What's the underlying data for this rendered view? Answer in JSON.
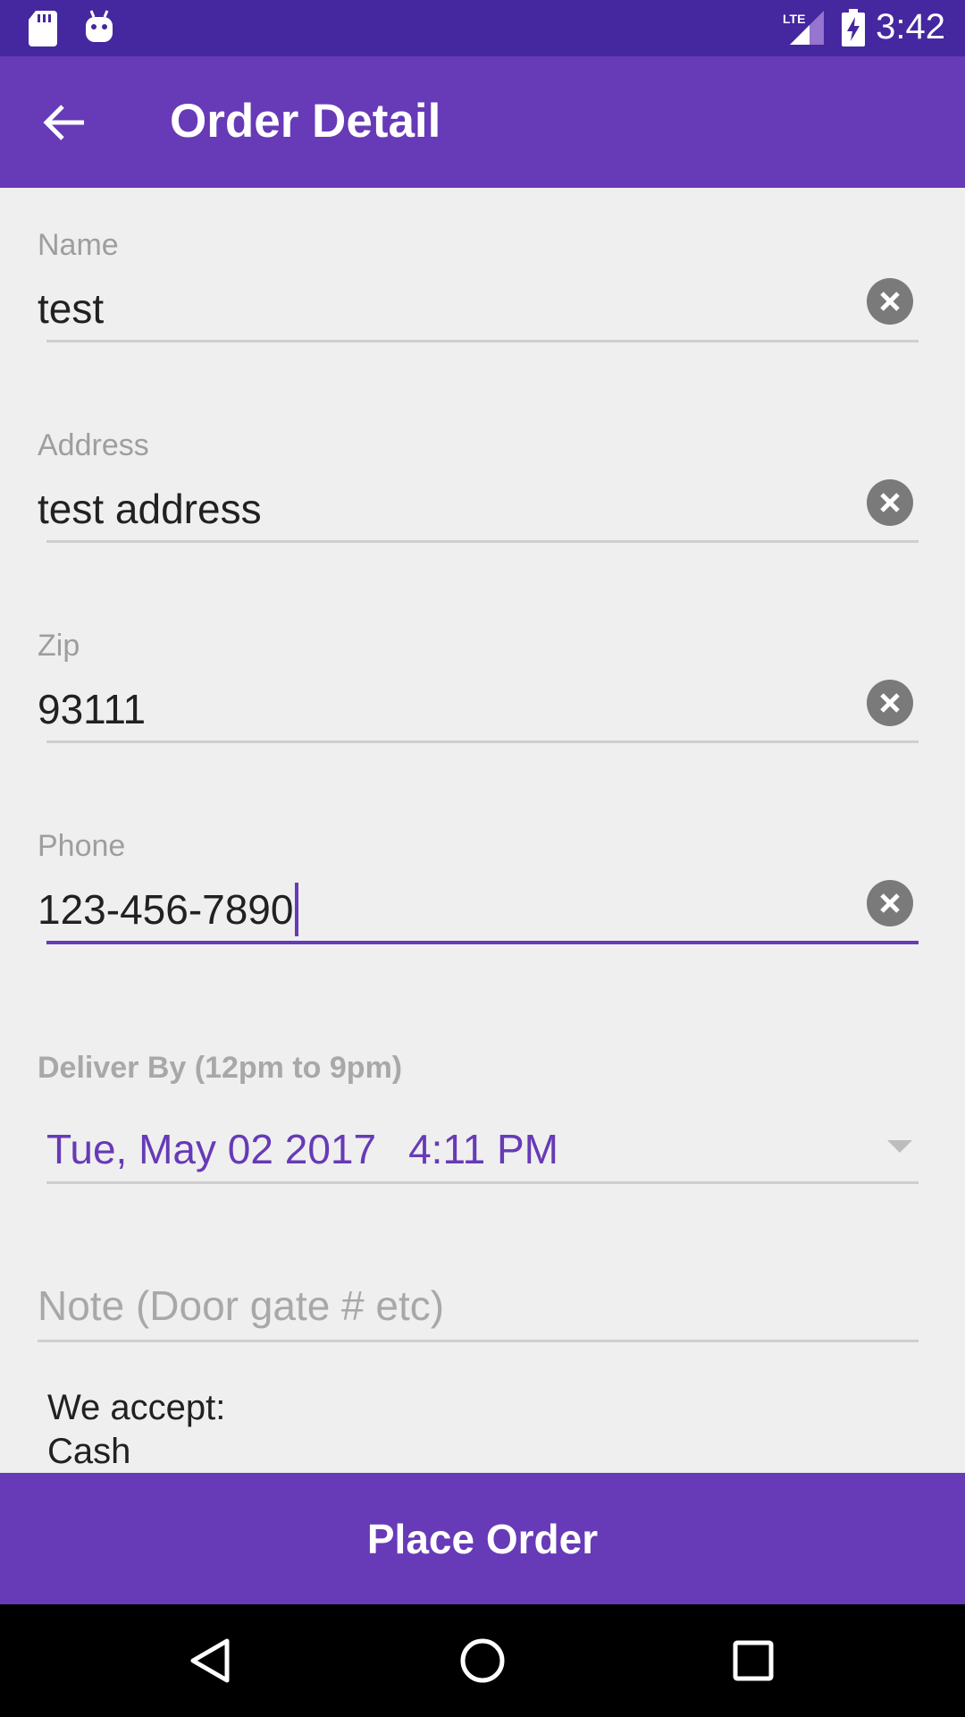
{
  "status_bar": {
    "time": "3:42",
    "network_label": "LTE",
    "icons": [
      "sd-card-icon",
      "android-icon",
      "lte-signal-icon",
      "battery-charging-icon"
    ]
  },
  "app_bar": {
    "title": "Order Detail",
    "back_icon": "arrow-back-icon"
  },
  "form": {
    "name": {
      "label": "Name",
      "value": "test"
    },
    "address": {
      "label": "Address",
      "value": "test address"
    },
    "zip": {
      "label": "Zip",
      "value": "93111"
    },
    "phone": {
      "label": "Phone",
      "value": "123-456-7890"
    },
    "deliver_by": {
      "label": "Deliver By (12pm to 9pm)",
      "date": "Tue, May 02 2017",
      "time": "4:11 PM"
    },
    "note": {
      "placeholder": "Note (Door gate # etc)"
    }
  },
  "payment": {
    "heading": "We accept:",
    "method": "Cash"
  },
  "place_order": {
    "label": "Place Order"
  },
  "colors": {
    "primary": "#673ab7",
    "primary_dark": "#4527a0",
    "background": "#efefef"
  }
}
